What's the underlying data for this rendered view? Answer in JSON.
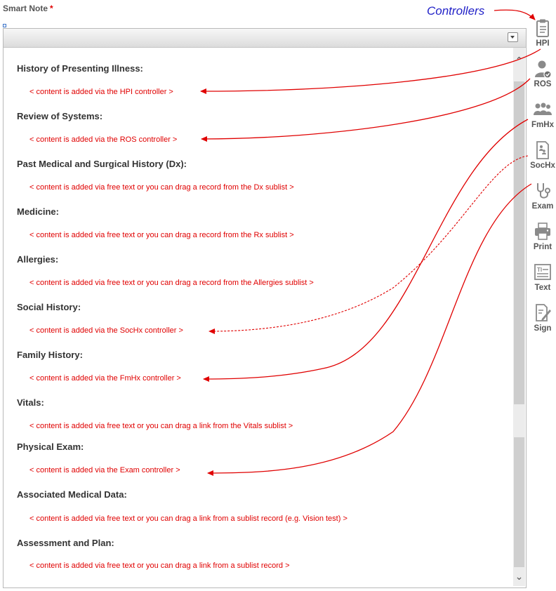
{
  "field": {
    "label": "Smart Note",
    "required_marker": "*"
  },
  "annotation": {
    "controllers": "Controllers"
  },
  "sections": [
    {
      "heading": "History of Presenting Illness:",
      "content": "< content is added via the HPI controller >"
    },
    {
      "heading": "Review of Systems:",
      "content": "< content is added via the ROS controller >"
    },
    {
      "heading": "Past Medical and Surgical History (Dx):",
      "content": "< content is added via free text or you can drag a record from the Dx sublist >"
    },
    {
      "heading": "Medicine:",
      "content": "< content is added via free text or you can drag a record from the Rx sublist >"
    },
    {
      "heading": "Allergies:",
      "content": "< content is added via free text or you can drag a record from the Allergies sublist >"
    },
    {
      "heading": "Social History:",
      "content": "< content is added via the SocHx controller >"
    },
    {
      "heading": "Family History:",
      "content": "< content is added via the FmHx controller >"
    },
    {
      "heading": "Vitals:",
      "content": "< content is added via free text or you can drag a link from the Vitals sublist >"
    },
    {
      "heading": "Physical Exam:",
      "content": "< content is added via the Exam controller >"
    },
    {
      "heading": "Associated Medical Data:",
      "content": "< content is added via free text or you can drag a link from a sublist record (e.g. Vision test) >"
    },
    {
      "heading": "Assessment and Plan:",
      "content": "< content is added via free text or you can drag a link from a sublist record >"
    }
  ],
  "sidebar": {
    "items": [
      {
        "label": "HPI",
        "icon": "clipboard-icon"
      },
      {
        "label": "ROS",
        "icon": "doctor-check-icon"
      },
      {
        "label": "FmHx",
        "icon": "family-icon"
      },
      {
        "label": "SocHx",
        "icon": "social-doc-icon"
      },
      {
        "label": "Exam",
        "icon": "stethoscope-icon"
      },
      {
        "label": "Print",
        "icon": "printer-icon"
      },
      {
        "label": "Text",
        "icon": "text-icon"
      },
      {
        "label": "Sign",
        "icon": "sign-pen-icon"
      }
    ]
  },
  "colors": {
    "content_text": "#e00000",
    "annotation_text": "#2222c8",
    "arrow": "#e00000",
    "icon": "#8a8a8a"
  }
}
